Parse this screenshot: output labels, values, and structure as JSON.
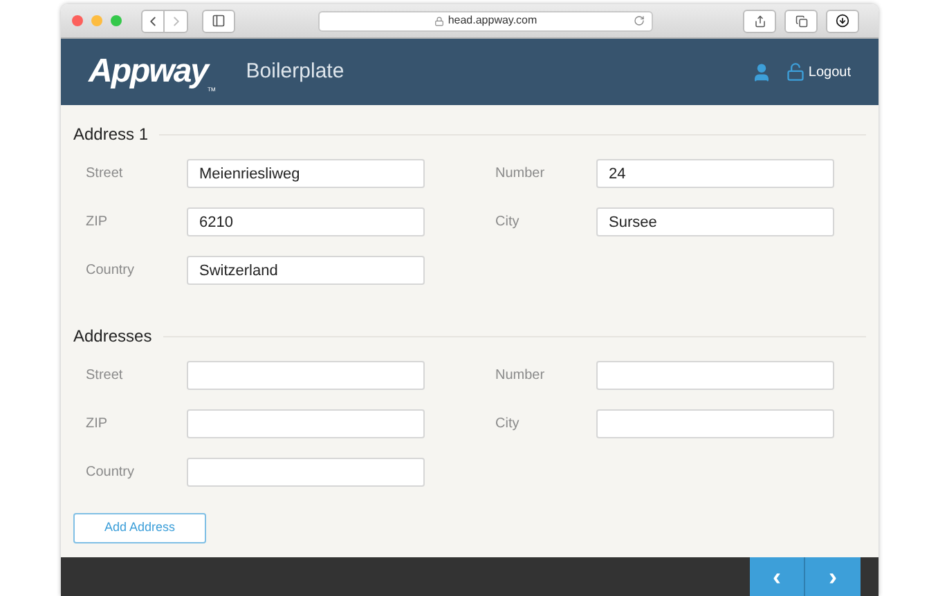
{
  "browser": {
    "url": "head.appway.com"
  },
  "header": {
    "logo": "Appway",
    "logo_mark": "TM",
    "title": "Boilerplate",
    "logout": "Logout"
  },
  "sections": [
    {
      "title": "Address 1",
      "fields": [
        {
          "label": "Street",
          "value": "Meienriesliweg"
        },
        {
          "label": "Number",
          "value": "24"
        },
        {
          "label": "ZIP",
          "value": "6210"
        },
        {
          "label": "City",
          "value": "Sursee"
        },
        {
          "label": "Country",
          "value": "Switzerland"
        }
      ]
    },
    {
      "title": "Addresses",
      "fields": [
        {
          "label": "Street"
        },
        {
          "label": "Number"
        },
        {
          "label": "ZIP"
        },
        {
          "label": "City"
        },
        {
          "label": "Country"
        }
      ]
    }
  ],
  "add_button": "Add Address",
  "footer": {
    "prev": "‹",
    "next": "›"
  }
}
